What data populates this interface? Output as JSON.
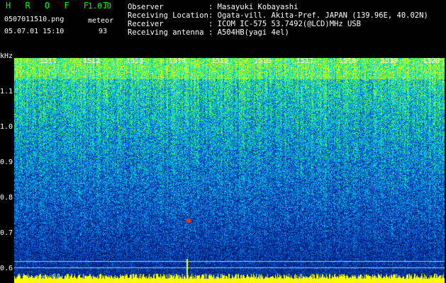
{
  "header": {
    "brand": "H R O F F T",
    "version": "1.0.0",
    "filename": "0507011510.png",
    "mode": "meteor",
    "datetime": "05.07.01 15:10",
    "count": "93"
  },
  "meta": [
    {
      "key": "Observer",
      "value": "Masayuki Kobayashi"
    },
    {
      "key": "Receiving Location",
      "value": "Ogata-vill. Akita-Pref. JAPAN (139.96E, 40.02N)"
    },
    {
      "key": "Receiver",
      "value": "ICOM IC-575 53.7492(@LCD)MHz USB"
    },
    {
      "key": "Receiving antenna",
      "value": "A504HB(yagi 4el)"
    }
  ],
  "axis": {
    "y_unit": "kHz",
    "y_ticks": [
      "1.1",
      "1.0",
      "0.9",
      "0.8",
      "0.7",
      "0.6"
    ],
    "x_ticks": [
      "1511",
      "1512",
      "1513",
      "1514",
      "1515",
      "1516",
      "1517",
      "1518",
      "1519",
      "1520"
    ]
  },
  "colors": {
    "brand": "#00ff00",
    "background": "#000000",
    "spectrum_low": "#001a7a",
    "spectrum_mid": "#00a0e0",
    "spectrum_high": "#40ff80",
    "baseline": "#ffff00",
    "echo": "#ff3000"
  },
  "spectrogram": {
    "meteor_echo_time": "1514",
    "meteor_echo_freq_khz": 0.73
  }
}
